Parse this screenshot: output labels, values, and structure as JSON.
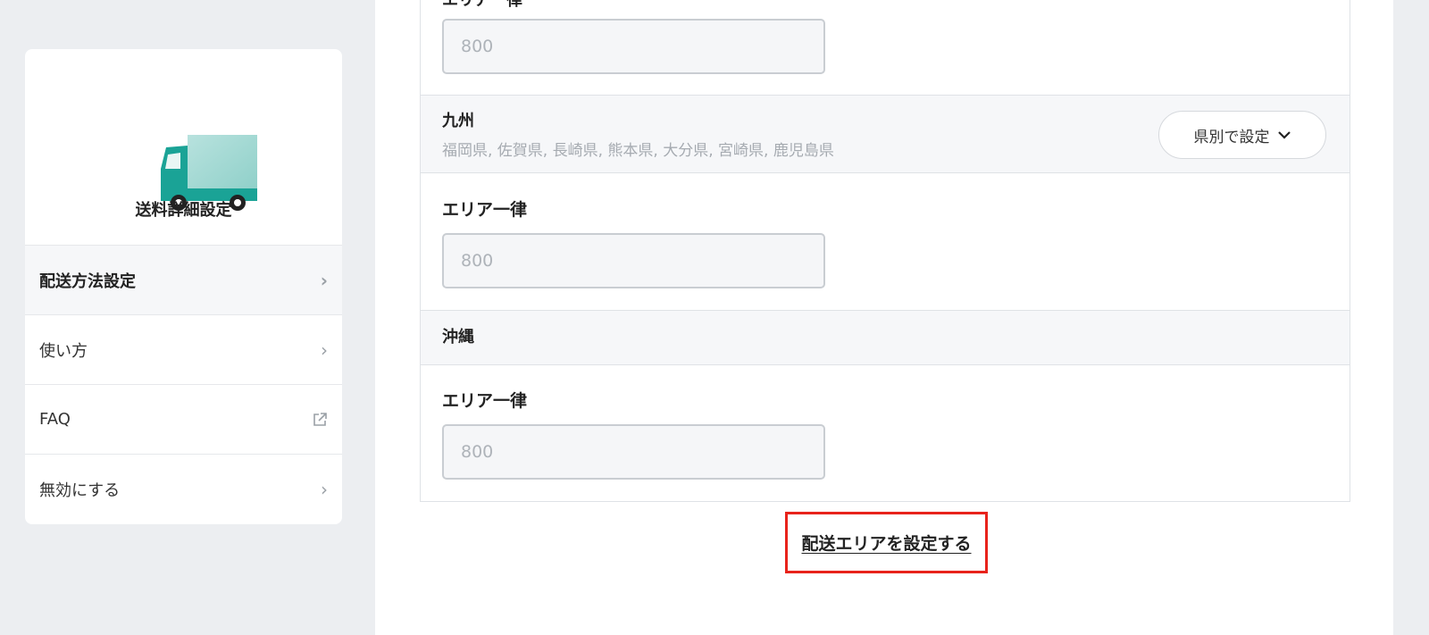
{
  "sidebar": {
    "title": "送料詳細設定",
    "items": [
      {
        "label": "配送方法設定",
        "icon": "chevron-right-icon"
      },
      {
        "label": "使い方",
        "icon": "chevron-right-icon"
      },
      {
        "label": "FAQ",
        "icon": "external-link-icon"
      },
      {
        "label": "無効にする",
        "icon": "chevron-right-icon"
      }
    ]
  },
  "main": {
    "top_label": "エリア一律",
    "top_input_placeholder": "800",
    "regions": [
      {
        "name": "九州",
        "prefectures": "福岡県, 佐賀県, 長崎県, 熊本県, 大分県, 宮崎県, 鹿児島県",
        "button_label": "県別で設定",
        "area_label": "エリア一律",
        "input_placeholder": "800"
      },
      {
        "name": "沖縄",
        "area_label": "エリア一律",
        "input_placeholder": "800"
      }
    ],
    "set_area_link": "配送エリアを設定する"
  },
  "colors": {
    "accent_teal": "#1aa396",
    "highlight_red": "#e8231b"
  }
}
